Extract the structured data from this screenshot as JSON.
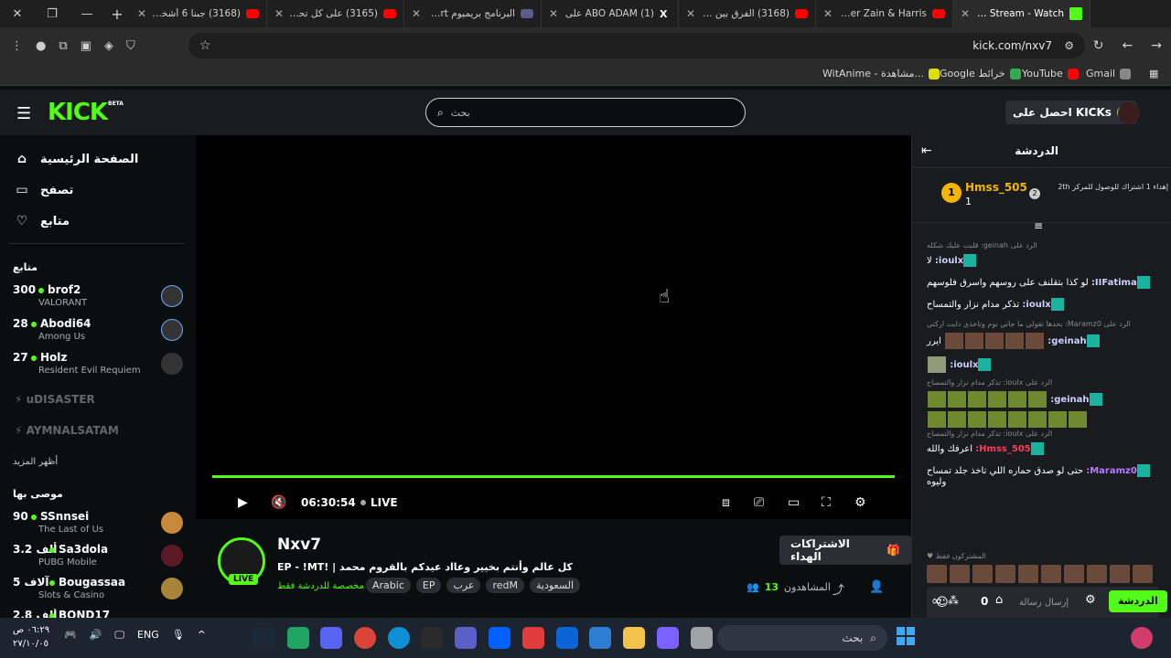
{
  "browser": {
    "tabs": [
      {
        "title": "(3168) جبنا 6 أشخاص",
        "favicon": "youtube"
      },
      {
        "title": "(3165) على كل تحدي",
        "favicon": "youtube"
      },
      {
        "title": "البرنامج بريميوم Alert",
        "favicon": "other"
      },
      {
        "title": "ABO ADAM (1) على",
        "favicon": "x"
      },
      {
        "title": "(3168) الفرق بين الملـ",
        "favicon": "youtube"
      },
      {
        "title": "Maher Zain & Harris",
        "favicon": "youtube"
      },
      {
        "title": "Nxv7 Stream - Watch",
        "favicon": "kick"
      }
    ],
    "url": "kick.com/nxv7",
    "bookmarks": [
      {
        "label": "WitAnime - مشاهدة...",
        "color": "#e0e000"
      },
      {
        "label": "Google خرائط",
        "color": "#34a853"
      },
      {
        "label": "YouTube",
        "color": "#ff0000"
      },
      {
        "label": "Gmail",
        "color": "#ea4335"
      }
    ]
  },
  "header": {
    "logo": "KICK",
    "beta": "BETA",
    "search_placeholder": "بحث",
    "kicks_label": "احصل على KICKs"
  },
  "sidebar": {
    "nav": [
      {
        "label": "الصفحة الرئيسية",
        "icon": "home-icon"
      },
      {
        "label": "تصفح",
        "icon": "browse-icon"
      },
      {
        "label": "متابع",
        "icon": "heart-icon"
      }
    ],
    "following_title": "متابع",
    "following": [
      {
        "count": "300",
        "name": "brof2",
        "game": "VALORANT"
      },
      {
        "count": "28",
        "name": "Abodi64",
        "game": "Among Us"
      },
      {
        "count": "27",
        "name": "Holz",
        "game": "Resident Evil Requiem"
      }
    ],
    "offline": [
      "uDISASTER",
      "AYMNALSATAM"
    ],
    "show_more": "أظهر المزيد",
    "recommended_title": "موصى بها",
    "recommended": [
      {
        "count": "90",
        "name": "SSnnsei",
        "game": "The Last of Us"
      },
      {
        "count": "3.2 ألف",
        "name": "Sa3dola",
        "game": "PUBG Mobile"
      },
      {
        "count": "5 آلاف",
        "name": "Bougassaa",
        "game": "Slots & Casino"
      },
      {
        "count": "2.8 ألف",
        "name": "BOND17",
        "game": ""
      }
    ]
  },
  "player": {
    "time": "06:30:54",
    "live": "LIVE"
  },
  "stream": {
    "streamer": "Nxv7",
    "title": "كل عالم وأنتم بخيير وعااد عيدكم بالقروم محمد | !EP - !MT",
    "chat_mode": "مخصصة للدردشة فقط",
    "tags": [
      "Arabic",
      "EP",
      "عرب",
      "redM",
      "السعودية"
    ],
    "live_badge": "LIVE",
    "gift_label": "الاشتراكات الهداء",
    "viewers_label": "المشاهدون",
    "viewers_count": "13"
  },
  "chat": {
    "title": "الدردشة",
    "pinned": {
      "user": "Hmss_505",
      "count": "1",
      "rank": "2",
      "text": "إهداء 1 اشتراك للوصول للمركز 2th"
    },
    "messages": [
      {
        "reply": "الرد على geinah: قلبت عليك شكله"
      },
      {
        "user": "ioulx:",
        "text": "لا",
        "color": "#c9d1ff"
      },
      {
        "user": "IIFatima:",
        "text": "لو كذا بتقلنف على روسهم واسرق فلوسهم",
        "color": "#c9d1ff"
      },
      {
        "user": "ioulx:",
        "text": "تذكر مدام نزار والتمساح",
        "color": "#c9d1ff"
      },
      {
        "reply": "الرد على Maramz0: بحدها تقولي ما جاني نوم وتاخذي دايت اركتي"
      },
      {
        "user": "geinah:",
        "text": "ايرر",
        "color": "#c9d1ff"
      },
      {
        "user": "ioulx:",
        "text": "",
        "color": "#c9d1ff"
      },
      {
        "reply": "الرد على ioulx: تذكر مدام نزار والتمساح"
      },
      {
        "user": "geinah:",
        "text": "",
        "color": "#c9d1ff"
      },
      {
        "reply": "الرد على ioulx: تذكر مدام نزار والتمساح"
      },
      {
        "user": "Hmss_505:",
        "text": "اعرفك والله",
        "color": "#ff3b5c"
      },
      {
        "user": "Maramz0:",
        "text": "حتى لو صدق حماره اللي تاخذ جلد تمساح وليوه",
        "color": "#b77bff"
      }
    ],
    "subs_only": "المشتركون فقط",
    "input_placeholder": "إرسال رسالة",
    "footer": {
      "points": "0",
      "chat_button": "الدردشة"
    }
  },
  "taskbar": {
    "clock_time": "٠٦:٢٩ ص",
    "clock_date": "٢٧/١٠/٠٥",
    "lang": "ENG",
    "search_placeholder": "بحث"
  }
}
